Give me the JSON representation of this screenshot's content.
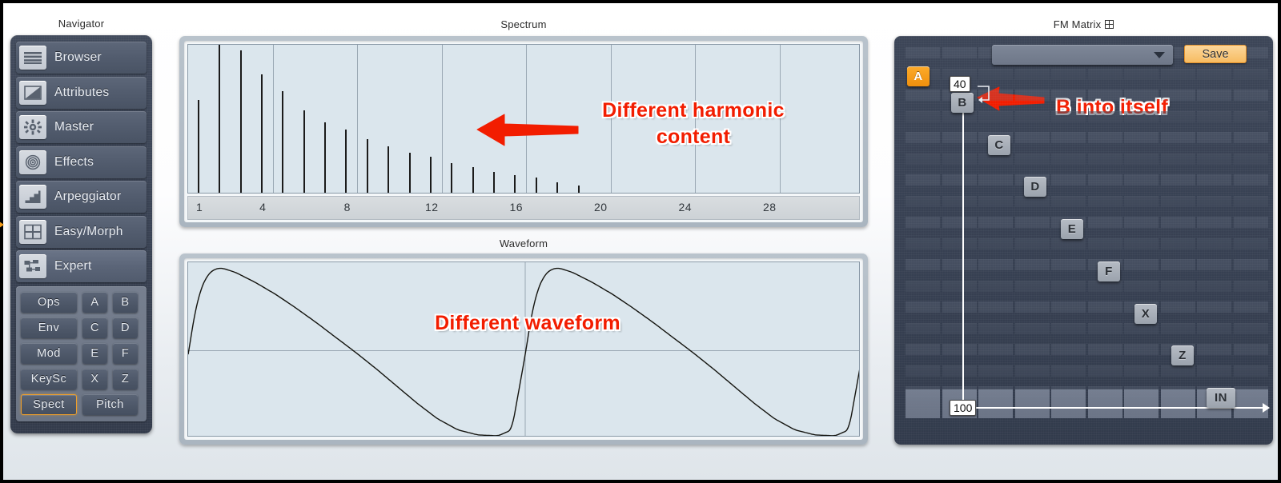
{
  "panels": {
    "navigator_title": "Navigator",
    "spectrum_title": "Spectrum",
    "waveform_title": "Waveform",
    "fm_matrix_title": "FM Matrix"
  },
  "navigator": {
    "items": [
      {
        "label": "Browser",
        "icon": "list-icon"
      },
      {
        "label": "Attributes",
        "icon": "diagonal-fill-icon"
      },
      {
        "label": "Master",
        "icon": "gear-icon"
      },
      {
        "label": "Effects",
        "icon": "concentric-circles-icon"
      },
      {
        "label": "Arpeggiator",
        "icon": "stairs-icon"
      },
      {
        "label": "Easy/Morph",
        "icon": "quadrant-grid-icon"
      },
      {
        "label": "Expert",
        "icon": "nodes-icon"
      }
    ],
    "active_item": "Expert",
    "sub_buttons": [
      [
        "Ops",
        "A",
        "B"
      ],
      [
        "Env",
        "C",
        "D"
      ],
      [
        "Mod",
        "E",
        "F"
      ],
      [
        "KeySc",
        "X",
        "Z"
      ],
      [
        "Spect",
        "Pitch"
      ]
    ],
    "selected_sub_button": "Spect"
  },
  "annotations": [
    {
      "id": "harmonic",
      "line1": "Different harmonic",
      "line2": "content"
    },
    {
      "id": "waveform",
      "line1": "Different waveform",
      "line2": ""
    },
    {
      "id": "b-into-itself",
      "line1": "B into itself",
      "line2": ""
    }
  ],
  "fm_matrix": {
    "preset_value": "",
    "preset_placeholder": "",
    "save_label": "Save",
    "operators": [
      {
        "label": "A",
        "accent": true
      },
      {
        "label": "B",
        "accent": false
      },
      {
        "label": "C",
        "accent": false
      },
      {
        "label": "D",
        "accent": false
      },
      {
        "label": "E",
        "accent": false
      },
      {
        "label": "F",
        "accent": false
      },
      {
        "label": "X",
        "accent": false
      },
      {
        "label": "Z",
        "accent": false
      },
      {
        "label": "IN",
        "accent": false
      }
    ],
    "values": [
      {
        "label": "40"
      },
      {
        "label": "100"
      }
    ]
  },
  "chart_data": [
    {
      "type": "bar",
      "title": "Spectrum",
      "xlabel": "",
      "ylabel": "",
      "grid": true,
      "legend": "none",
      "xlim": [
        0.5,
        31.5
      ],
      "ylim": [
        0,
        100
      ],
      "tick_labels": [
        1,
        4,
        8,
        12,
        16,
        20,
        24,
        28
      ],
      "categories": [
        1,
        2,
        3,
        4,
        5,
        6,
        7,
        8,
        9,
        10,
        11,
        12,
        13,
        14,
        15,
        16,
        17,
        18,
        19,
        20,
        21,
        22,
        23,
        24,
        25,
        26,
        27,
        28,
        29,
        30,
        31,
        32
      ],
      "values": [
        62,
        100,
        95,
        79,
        68,
        55,
        47,
        42,
        36,
        31,
        27,
        24,
        20,
        17,
        14,
        12,
        10,
        7,
        5,
        0,
        0,
        0,
        0,
        0,
        0,
        0,
        0,
        0,
        0,
        0,
        0,
        0
      ]
    },
    {
      "type": "line",
      "title": "Waveform",
      "xlabel": "",
      "ylabel": "",
      "grid": true,
      "legend": "none",
      "xlim": [
        0,
        2
      ],
      "ylim": [
        -1,
        1
      ],
      "description": "Two cycles of an asymmetric saw-like wave: rapid rise to peak near 10% of cycle then slow decay to trough near end of cycle",
      "x": [
        0.0,
        0.02,
        0.04,
        0.06,
        0.08,
        0.1,
        0.14,
        0.2,
        0.26,
        0.32,
        0.38,
        0.44,
        0.5,
        0.56,
        0.62,
        0.68,
        0.74,
        0.8,
        0.86,
        0.92,
        0.96,
        1.0
      ],
      "y": [
        -0.05,
        0.45,
        0.75,
        0.9,
        0.96,
        0.97,
        0.92,
        0.8,
        0.66,
        0.5,
        0.33,
        0.15,
        -0.03,
        -0.22,
        -0.42,
        -0.62,
        -0.8,
        -0.93,
        -0.99,
        -1.0,
        -0.93,
        -0.05
      ]
    }
  ]
}
